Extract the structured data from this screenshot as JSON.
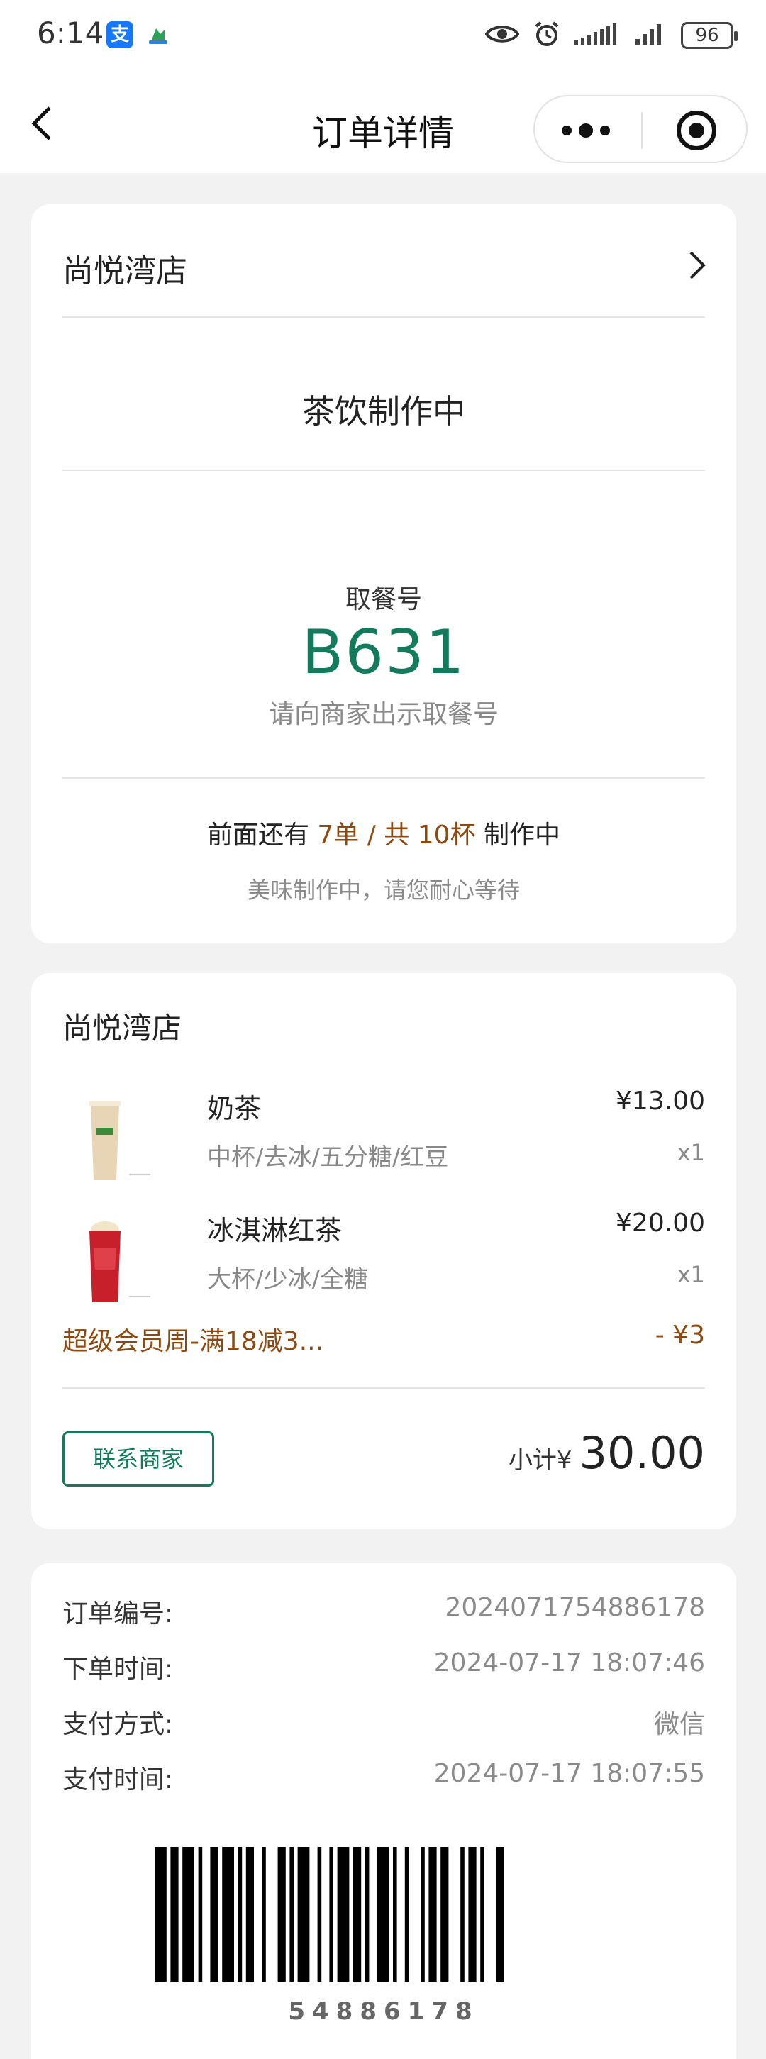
{
  "status_bar": {
    "time": "6:14",
    "alipay_icon_text": "支",
    "battery": "96",
    "icons": [
      "alipay-icon",
      "app-icon",
      "eye-icon",
      "alarm-icon",
      "signal-icon",
      "signal-icon",
      "battery-icon"
    ]
  },
  "nav": {
    "title": "订单详情",
    "back_icon": "chevron-left-icon",
    "more_icon": "more-dots-icon",
    "target_icon": "target-icon"
  },
  "status_card": {
    "store_name": "尚悦湾店",
    "status": "茶饮制作中",
    "pickup_label": "取餐号",
    "pickup_number": "B631",
    "pickup_hint": "请向商家出示取餐号",
    "queue_prefix": "前面还有 ",
    "queue_orders": "7单 / 共 10杯",
    "queue_suffix": " 制作中",
    "queue_sub": "美味制作中，请您耐心等待"
  },
  "order_card": {
    "store_name": "尚悦湾店",
    "items": [
      {
        "name": "奶茶",
        "spec": "中杯/去冰/五分糖/红豆",
        "price": "¥13.00",
        "qty": "x1"
      },
      {
        "name": "冰淇淋红茶",
        "spec": "大杯/少冰/全糖",
        "price": "¥20.00",
        "qty": "x1"
      }
    ],
    "promo_name": "超级会员周-满18减3...",
    "promo_value": "- ¥3",
    "contact_label": "联系商家",
    "subtotal_label": "小计¥",
    "subtotal_value": "30.00"
  },
  "info_card": {
    "rows": [
      {
        "label": "订单编号:",
        "value": "2024071754886178"
      },
      {
        "label": "下单时间:",
        "value": "2024-07-17 18:07:46"
      },
      {
        "label": "支付方式:",
        "value": "微信"
      },
      {
        "label": "支付时间:",
        "value": "2024-07-17 18:07:55"
      }
    ],
    "barcode_text": "54886178"
  },
  "colors": {
    "accent_green": "#137a5c",
    "promo_brown": "#8b4a12",
    "background": "#f2f2f2"
  }
}
